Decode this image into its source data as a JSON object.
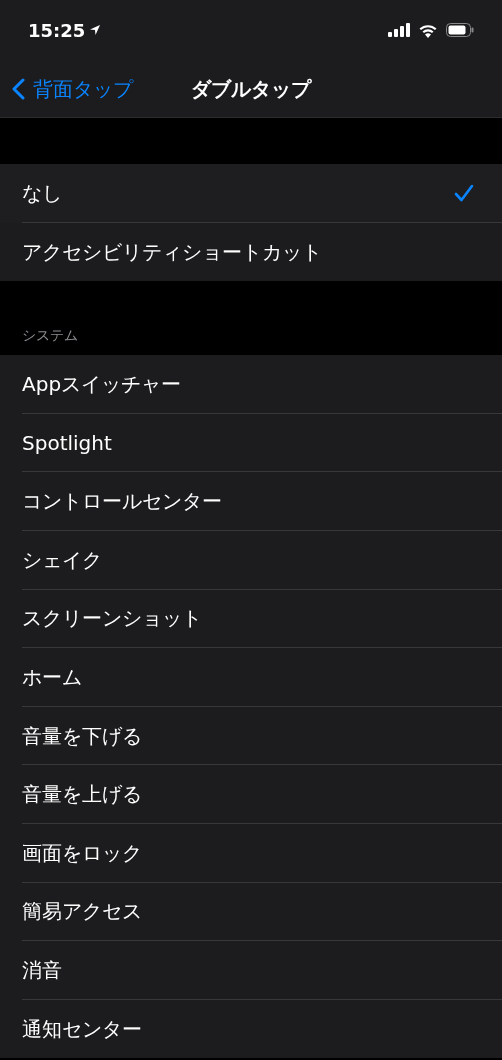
{
  "status_bar": {
    "time": "15:25"
  },
  "nav": {
    "back": "背面タップ",
    "title": "ダブルタップ"
  },
  "groups": [
    {
      "rows": [
        {
          "label": "なし",
          "selected": true
        },
        {
          "label": "アクセシビリティショートカット",
          "selected": false
        }
      ]
    },
    {
      "header": "システム",
      "rows": [
        {
          "label": "Appスイッチャー",
          "selected": false
        },
        {
          "label": "Spotlight",
          "selected": false
        },
        {
          "label": "コントロールセンター",
          "selected": false
        },
        {
          "label": "シェイク",
          "selected": false
        },
        {
          "label": "スクリーンショット",
          "selected": false
        },
        {
          "label": "ホーム",
          "selected": false
        },
        {
          "label": "音量を下げる",
          "selected": false
        },
        {
          "label": "音量を上げる",
          "selected": false
        },
        {
          "label": "画面をロック",
          "selected": false
        },
        {
          "label": "簡易アクセス",
          "selected": false
        },
        {
          "label": "消音",
          "selected": false
        },
        {
          "label": "通知センター",
          "selected": false
        }
      ]
    }
  ]
}
